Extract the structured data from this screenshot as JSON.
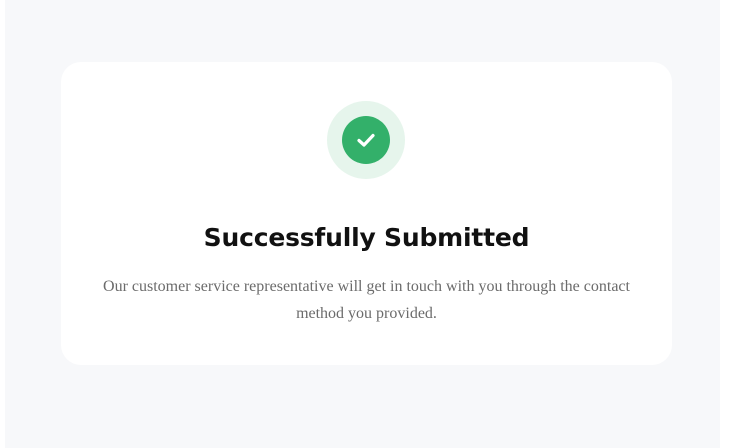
{
  "result": {
    "status_icon": "check-circle-icon",
    "title": "Successfully Submitted",
    "description": "Our customer service representative will get in touch with you through the contact method you provided."
  },
  "colors": {
    "page_background": "#f7f8fa",
    "card_background": "#ffffff",
    "success_green": "#33b06a",
    "success_green_light": "#e6f5ec"
  }
}
